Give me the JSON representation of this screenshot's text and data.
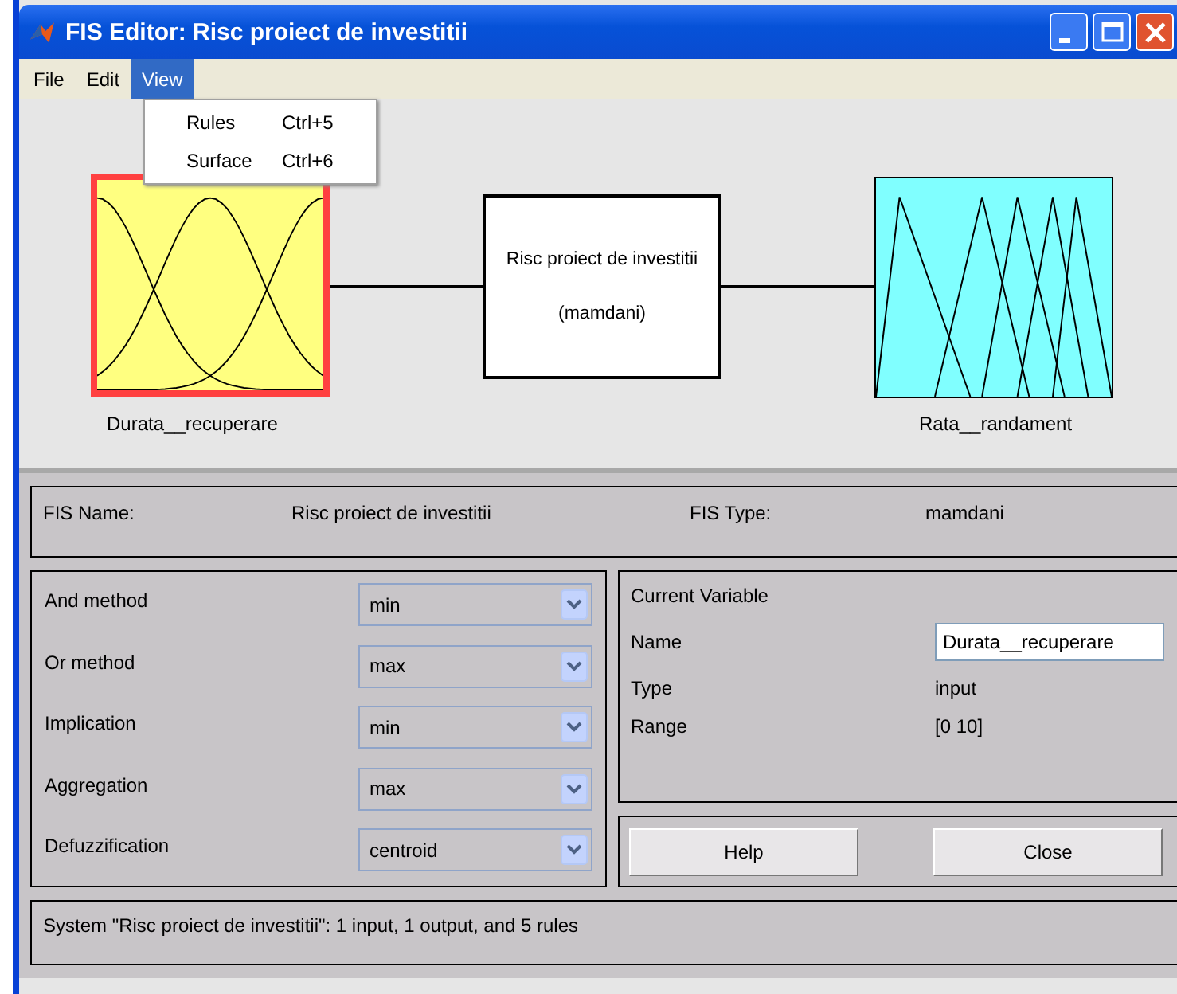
{
  "window": {
    "title": "FIS Editor: Risc proiect de investitii"
  },
  "menu": [
    {
      "label": "File",
      "selected": false
    },
    {
      "label": "Edit",
      "selected": false
    },
    {
      "label": "View",
      "selected": true
    }
  ],
  "dropdown": [
    {
      "label": "Rules",
      "shortcut": "Ctrl+5"
    },
    {
      "label": "Surface",
      "shortcut": "Ctrl+6"
    }
  ],
  "diagram": {
    "input": {
      "name": "Durata__recuperare",
      "selected": true
    },
    "system": {
      "name": "Risc proiect de investitii",
      "type": "(mamdani)"
    },
    "output": {
      "name": "Rata__randament",
      "selected": false
    }
  },
  "fis": {
    "name_label": "FIS Name:",
    "name": "Risc proiect de investitii",
    "type_label": "FIS Type:",
    "type": "mamdani"
  },
  "methods": [
    {
      "label": "And method",
      "value": "min"
    },
    {
      "label": "Or method",
      "value": "max"
    },
    {
      "label": "Implication",
      "value": "min"
    },
    {
      "label": "Aggregation",
      "value": "max"
    },
    {
      "label": "Defuzzification",
      "value": "centroid"
    }
  ],
  "current_variable": {
    "title": "Current Variable",
    "name_label": "Name",
    "name": "Durata__recuperare",
    "type_label": "Type",
    "type": "input",
    "range_label": "Range",
    "range": "[0 10]"
  },
  "buttons": [
    "Help",
    "Close"
  ],
  "status": "System \"Risc proiect de investitii\": 1 input, 1 output, and 5 rules"
}
